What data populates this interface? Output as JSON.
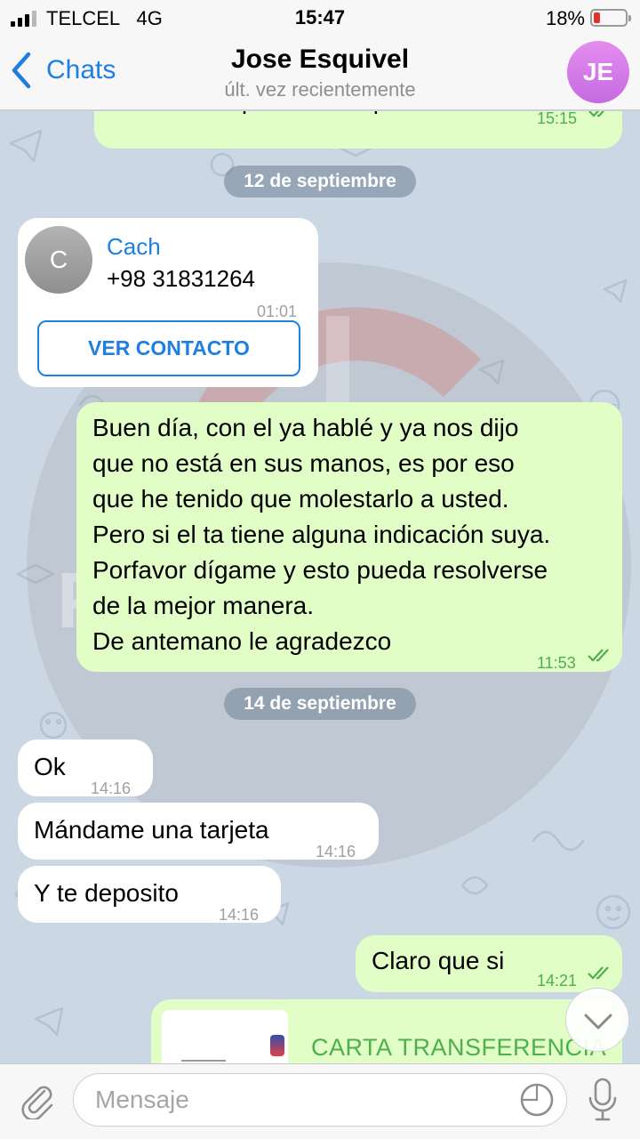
{
  "status_bar": {
    "carrier": "TELCEL",
    "network": "4G",
    "time": "15:47",
    "battery_percent": "18%",
    "battery_level": 0.18,
    "battery_color": "#e0312b"
  },
  "header": {
    "back_label": "Chats",
    "contact_name": "Jose Esquivel",
    "last_seen": "últ. vez recientemente",
    "avatar_initials": "JE",
    "avatar_color": "#d27ce8"
  },
  "messages": [
    {
      "type": "out",
      "text": "Saludos de parte de mi  padre",
      "time": "15:15",
      "read": true
    },
    {
      "type": "date",
      "text": "12 de septiembre"
    },
    {
      "type": "contact",
      "initial": "C",
      "name": "Cach",
      "phone": "+98 31831264",
      "time": "01:01",
      "button": "VER CONTACTO"
    },
    {
      "type": "out",
      "lines": [
        "Buen día, con el ya hablé y ya nos dijo",
        "que no está en sus manos, es por eso",
        "que he tenido que molestarlo a usted.",
        "Pero si el ta tiene alguna indicación suya.",
        "Porfavor dígame y esto pueda resolverse",
        "de la mejor manera.",
        "De antemano le agradezco"
      ],
      "time": "11:53",
      "read": true
    },
    {
      "type": "date",
      "text": "14 de septiembre"
    },
    {
      "type": "in",
      "text": "Ok",
      "time": "14:16"
    },
    {
      "type": "in",
      "text": "Mándame una tarjeta",
      "time": "14:16"
    },
    {
      "type": "in",
      "text": "Y te deposito",
      "time": "14:16"
    },
    {
      "type": "out",
      "text": "Claro que si",
      "time": "14:21",
      "read": true
    },
    {
      "type": "out-file",
      "title": "CARTA TRANSFERENCIA"
    }
  ],
  "watermark": {
    "title": "PERIODISMO",
    "subtitle": "SIN PERMISO"
  },
  "input": {
    "placeholder": "Mensaje"
  },
  "colors": {
    "accent": "#1f7fe0",
    "outgoing_bubble": "#e1fec6",
    "incoming_bubble": "#ffffff",
    "read_check": "#4fae4e",
    "chat_background": "#cbd7e3"
  }
}
